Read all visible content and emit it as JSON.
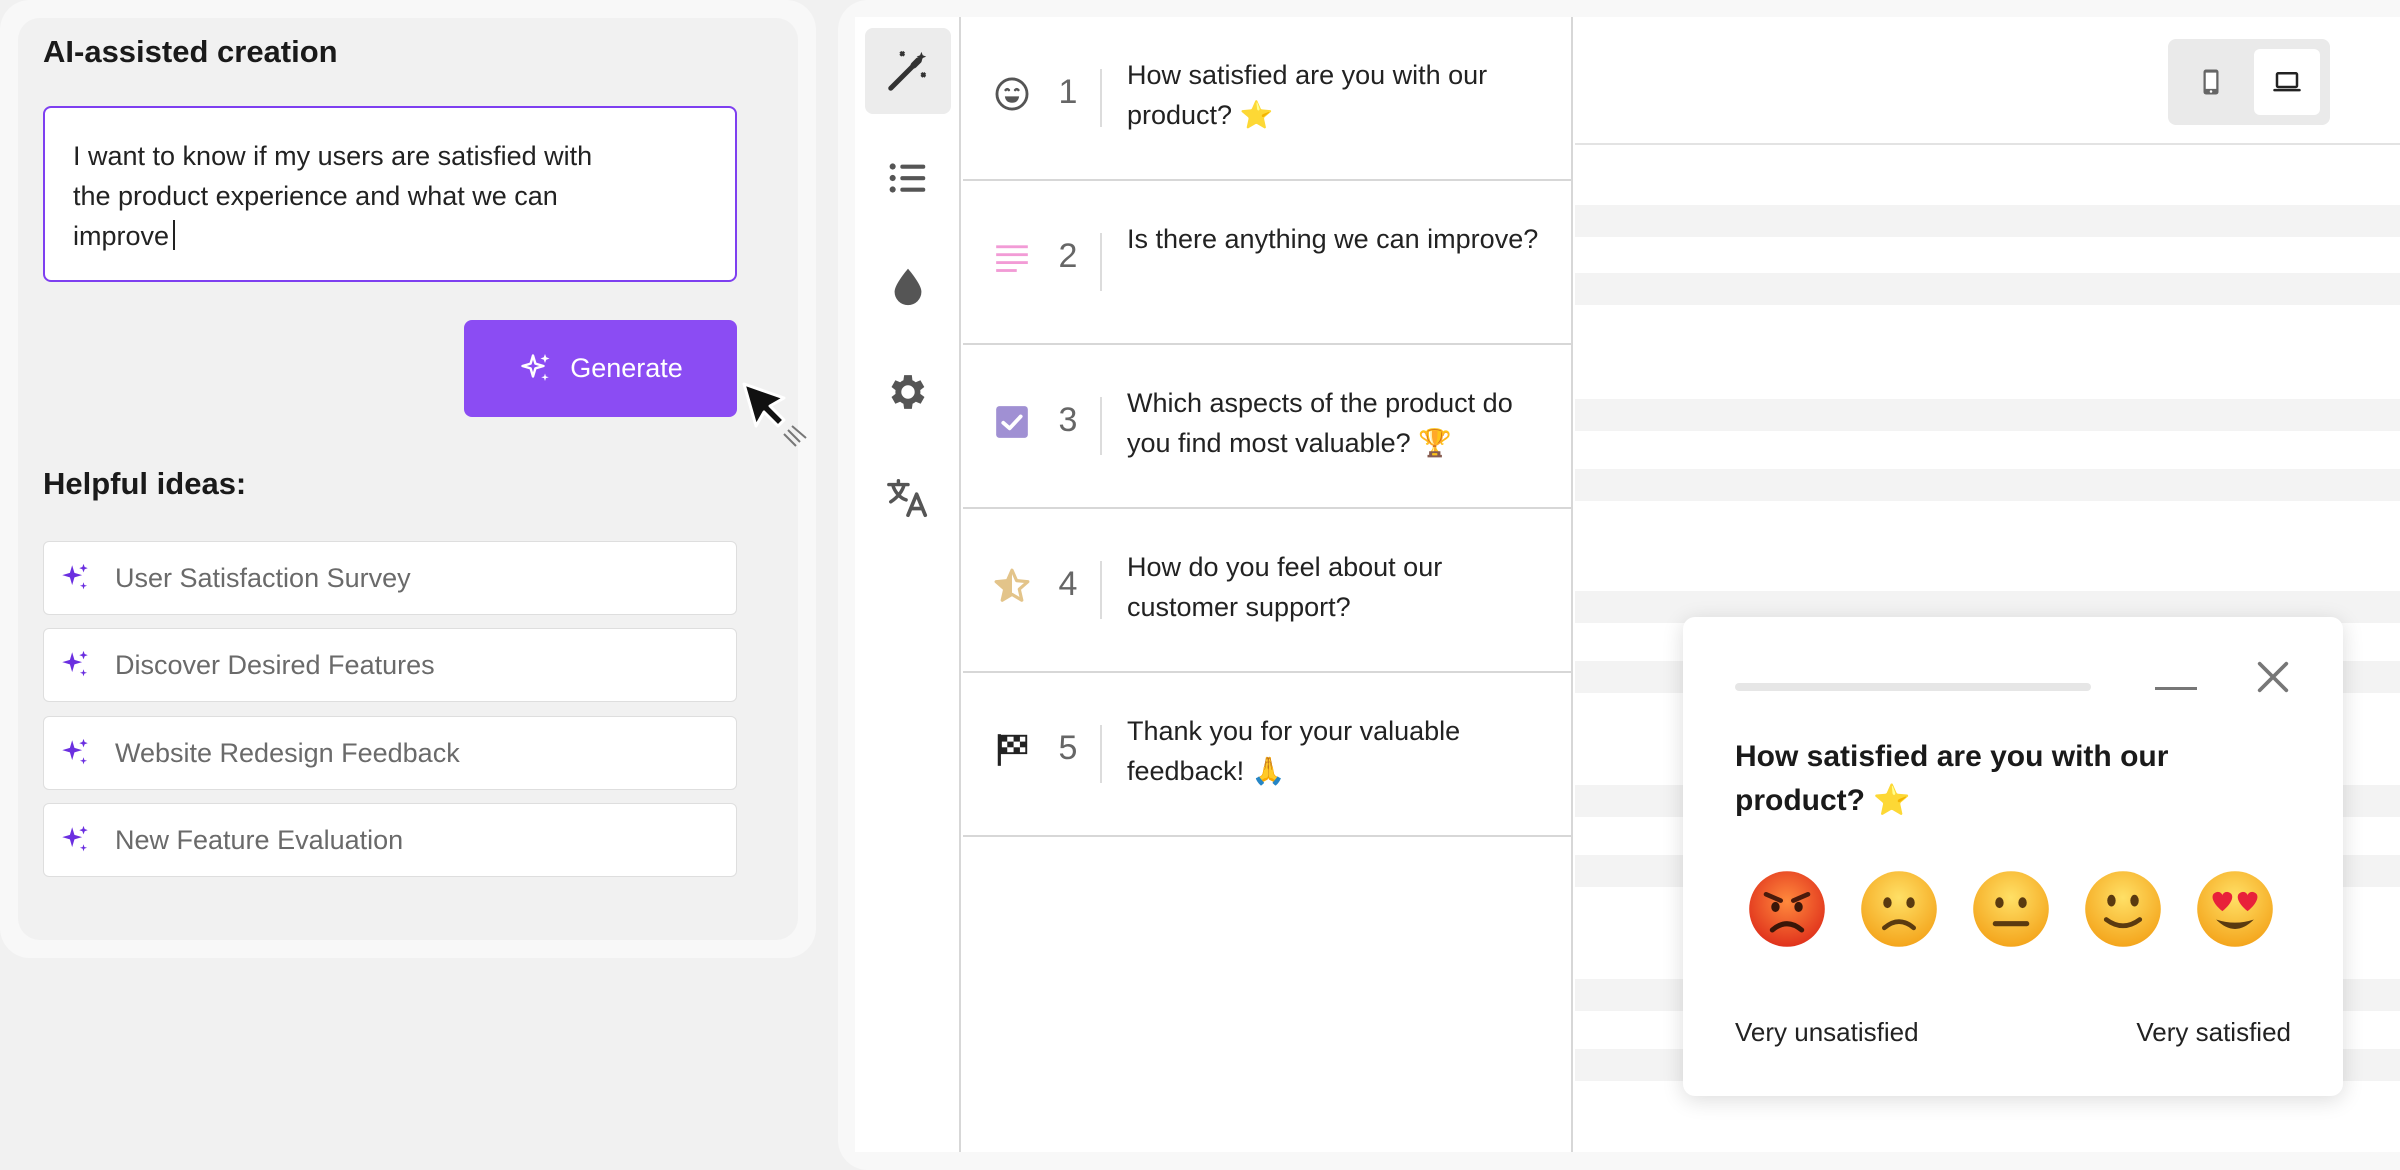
{
  "ai_panel": {
    "title": "AI-assisted creation",
    "prompt_text": "I want to know if my users are satisfied with the product experience and what we can improve",
    "generate_label": "Generate",
    "ideas_title": "Helpful ideas:",
    "ideas": [
      {
        "label": "User Satisfaction Survey"
      },
      {
        "label": "Discover Desired Features"
      },
      {
        "label": "Website Redesign Feedback"
      },
      {
        "label": "New Feature Evaluation"
      }
    ]
  },
  "rail": {
    "items": [
      {
        "icon": "magic-wand-icon",
        "active": true
      },
      {
        "icon": "list-icon"
      },
      {
        "icon": "drop-icon"
      },
      {
        "icon": "gear-icon"
      },
      {
        "icon": "translate-icon"
      }
    ]
  },
  "questions": [
    {
      "number": "1",
      "icon": "smiley-icon",
      "text": "How satisfied are you with our product? ⭐"
    },
    {
      "number": "2",
      "icon": "text-lines-icon",
      "text": "Is there anything we can improve?"
    },
    {
      "number": "3",
      "icon": "checkbox-icon",
      "text": "Which aspects of the product do you find most valuable? 🏆"
    },
    {
      "number": "4",
      "icon": "star-icon",
      "text": "How do you feel about our customer support?"
    },
    {
      "number": "5",
      "icon": "checkered-flag-icon",
      "text": "Thank you for your valuable feedback! 🙏"
    }
  ],
  "preview": {
    "device_toggle": {
      "options": [
        "mobile-icon",
        "laptop-icon"
      ],
      "selected": "laptop-icon"
    },
    "popup": {
      "question": "How satisfied are you with our product? ⭐",
      "low_label": "Very unsatisfied",
      "high_label": "Very satisfied",
      "ratings": [
        "angry-face-icon",
        "frowning-face-icon",
        "neutral-face-icon",
        "slight-smile-icon",
        "heart-eyes-icon"
      ]
    }
  },
  "colors": {
    "accent": "#8b4cf3",
    "prompt_border": "#7e3ff0"
  }
}
